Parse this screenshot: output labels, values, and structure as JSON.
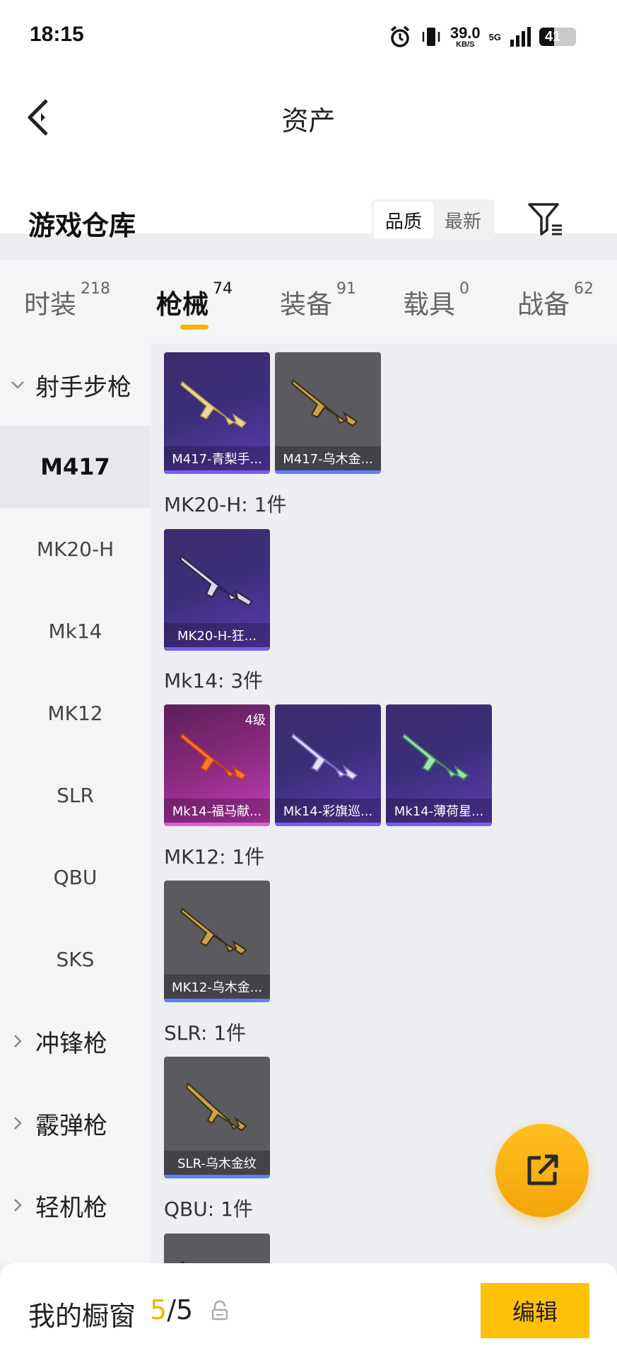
{
  "status_bar": {
    "time": "18:15",
    "net_speed_value": "39.0",
    "net_speed_unit": "KB/S",
    "network": "5G",
    "battery": "41"
  },
  "header": {
    "title": "资产"
  },
  "warehouse": {
    "title": "游戏仓库",
    "sort_options": [
      "品质",
      "最新"
    ],
    "sort_selected": "品质"
  },
  "tabs": [
    {
      "label": "时装",
      "count": "218"
    },
    {
      "label": "枪械",
      "count": "74",
      "active": true
    },
    {
      "label": "装备",
      "count": "91"
    },
    {
      "label": "载具",
      "count": "0"
    },
    {
      "label": "战备",
      "count": "62"
    }
  ],
  "sidebar": {
    "groups": [
      {
        "label": "射手步枪",
        "expanded": true,
        "items": [
          "M417",
          "MK20-H",
          "Mk14",
          "MK12",
          "SLR",
          "QBU",
          "SKS"
        ],
        "selected": "M417"
      },
      {
        "label": "冲锋枪",
        "expanded": false
      },
      {
        "label": "霰弹枪",
        "expanded": false
      },
      {
        "label": "轻机枪",
        "expanded": false
      }
    ]
  },
  "content": {
    "groups": [
      {
        "label": "",
        "items": [
          {
            "name": "M417-青梨手...",
            "rarity": "purple"
          },
          {
            "name": "M417-乌木金...",
            "rarity": "grey"
          }
        ]
      },
      {
        "label": "MK20-H: 1件",
        "items": [
          {
            "name": "MK20-H-狂...",
            "rarity": "purple"
          }
        ]
      },
      {
        "label": "Mk14: 3件",
        "items": [
          {
            "name": "Mk14-福马献...",
            "rarity": "pink",
            "level": "4级"
          },
          {
            "name": "Mk14-彩旗巡...",
            "rarity": "purple"
          },
          {
            "name": "Mk14-薄荷星...",
            "rarity": "purple"
          }
        ]
      },
      {
        "label": "MK12: 1件",
        "items": [
          {
            "name": "MK12-乌木金...",
            "rarity": "grey"
          }
        ]
      },
      {
        "label": "SLR: 1件",
        "items": [
          {
            "name": "SLR-乌木金纹",
            "rarity": "grey"
          }
        ]
      },
      {
        "label": "QBU: 1件",
        "items": [
          {
            "name": "",
            "rarity": "grey"
          }
        ]
      }
    ]
  },
  "bottom_bar": {
    "label": "我的橱窗",
    "count_current": "5",
    "count_total": "/5",
    "edit_label": "编辑"
  },
  "colors": {
    "accent": "#f5b400",
    "button": "#ffc107",
    "purple_card": "#3b2e78",
    "grey_card": "#5a5a5f",
    "pink_card": "#8a2a7e"
  }
}
